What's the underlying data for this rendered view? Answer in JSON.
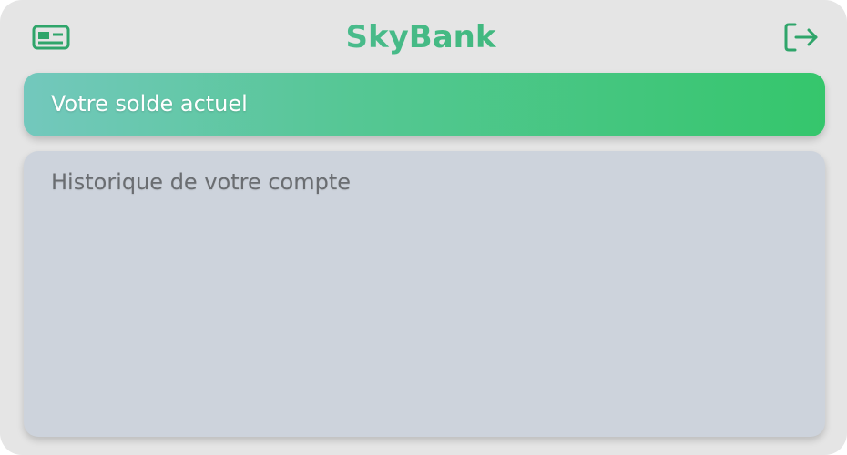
{
  "header": {
    "title": "SkyBank",
    "left_icon": "card-icon",
    "right_icon": "logout-icon"
  },
  "balance": {
    "label": "Votre solde actuel"
  },
  "history": {
    "title": "Historique de votre compte"
  },
  "colors": {
    "background": "#e5e5e5",
    "accent_green": "#2fb463",
    "accent_teal": "#73c8bd",
    "history_bg": "#cdd3dc",
    "history_text": "#6a6d71"
  }
}
